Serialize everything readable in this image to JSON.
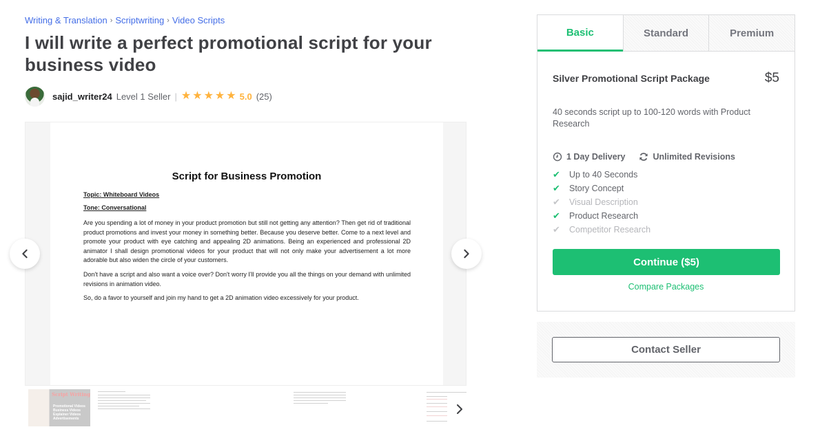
{
  "breadcrumb": {
    "items": [
      "Writing & Translation",
      "Scriptwriting",
      "Video Scripts"
    ],
    "separator": "›"
  },
  "gig": {
    "title": "I will write a perfect promotional script for your business video"
  },
  "seller": {
    "username": "sajid_writer24",
    "level": "Level 1 Seller",
    "divider": "|",
    "star_glyph": "★",
    "rating": "5.0",
    "stars": 5,
    "reviews": "(25)"
  },
  "gallery": {
    "slide": {
      "heading": "Script for Business Promotion",
      "topic": "Topic: Whiteboard Videos",
      "tone": "Tone: Conversational",
      "paragraphs": [
        "Are you spending a lot of money in your product promotion but still not getting any attention? Then get rid of traditional product promotions and invest your money in something better. Because you deserve better. Come to a next level and promote your product with eye catching and appealing 2D animations. Being an experienced and professional 2D animator I shall design promotional videos for your product that will not only make your advertisement a lot more adorable but also widen the circle of your customers.",
        "Don't have a script and also want a voice over? Don't worry I'll provide you all the things on your demand with unlimited revisions in animation video.",
        "So, do a favor to yourself and join my hand to get a 2D animation video excessively for your product."
      ]
    },
    "thumbnails": {
      "first": {
        "title": "Script Writing",
        "items": [
          "Promotional Videos",
          "Business Videos",
          "Explainer Videos",
          "Advertisements"
        ]
      }
    }
  },
  "packages": {
    "tabs": [
      {
        "label": "Basic",
        "active": true
      },
      {
        "label": "Standard",
        "active": false
      },
      {
        "label": "Premium",
        "active": false
      }
    ],
    "selected": {
      "name": "Silver Promotional Script Package",
      "price": "$5",
      "description": "40 seconds script up to 100-120 words with Product Research",
      "delivery": "1 Day Delivery",
      "revisions": "Unlimited Revisions",
      "features": [
        {
          "label": "Up to 40 Seconds",
          "included": true
        },
        {
          "label": "Story Concept",
          "included": true
        },
        {
          "label": "Visual Description",
          "included": false
        },
        {
          "label": "Product Research",
          "included": true
        },
        {
          "label": "Competitor Research",
          "included": false
        }
      ],
      "check_glyph": "✔"
    },
    "continue_label": "Continue ($5)",
    "compare_label": "Compare Packages"
  },
  "contact": {
    "label": "Contact Seller"
  },
  "colors": {
    "brand_green": "#1dbf73",
    "link_blue": "#446ee7",
    "star_yellow": "#ffb33e",
    "text_dark": "#404145"
  }
}
